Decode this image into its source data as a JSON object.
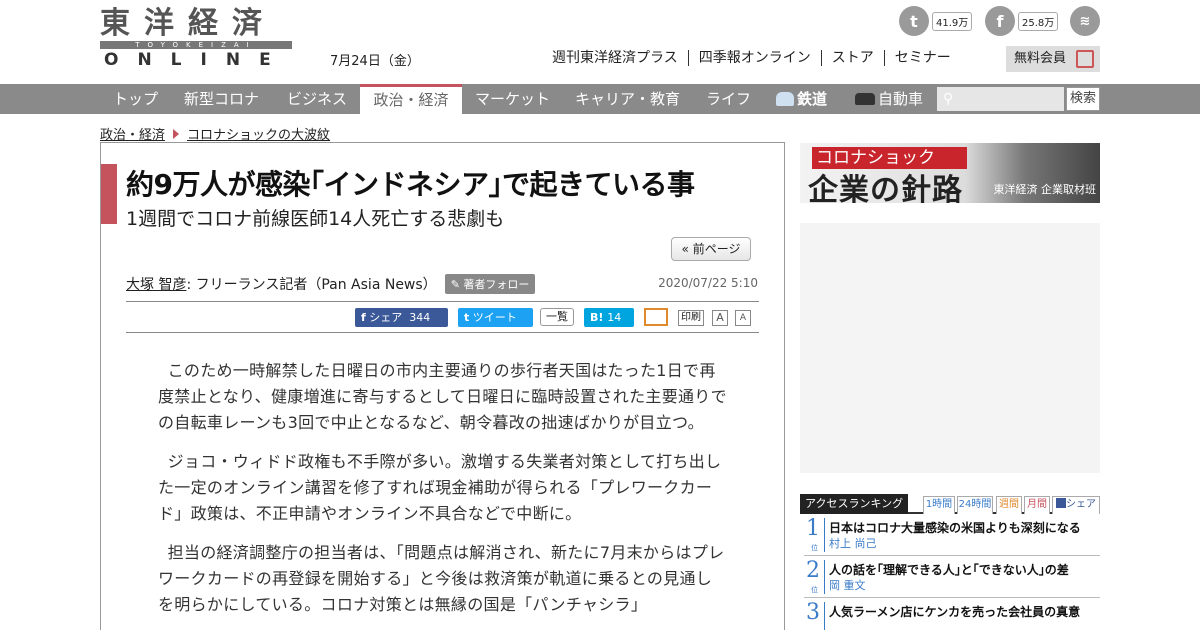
{
  "header": {
    "logo_jp": "東洋経済",
    "logo_bar": "TOYOKEIZAI",
    "logo_en": "ONLINE",
    "date": "7月24日（金）",
    "top_links": [
      "週刊東洋経済プラス",
      "四季報オンライン",
      "ストア",
      "セミナー"
    ],
    "member_label": "無料会員",
    "social": {
      "twitter_count": "41.9万",
      "facebook_count": "25.8万"
    }
  },
  "nav": {
    "items": [
      "トップ",
      "新型コロナ",
      "ビジネス",
      "政治・経済",
      "マーケット",
      "キャリア・教育",
      "ライフ",
      "鉄道",
      "自動車"
    ],
    "active": "政治・経済",
    "search_button": "検索"
  },
  "breadcrumb": [
    "政治・経済",
    "コロナショックの大波紋"
  ],
  "article": {
    "title": "約9万人が感染｢インドネシア｣で起きている事",
    "subtitle": "1週間でコロナ前線医師14人死亡する悲劇も",
    "prev_button": "« 前ページ",
    "author_name": "大塚 智彦",
    "author_role": " : フリーランス記者（Pan Asia News）",
    "follow_label": "著者フォロー",
    "published": "2020/07/22 5:10",
    "share": {
      "fb_label": "シェア",
      "fb_count": "344",
      "tw_label": "ツイート",
      "list_label": "一覧",
      "hb_count": "14",
      "print_label": "印刷",
      "font_large": "A",
      "font_small": "A"
    },
    "paragraphs": [
      "このため一時解禁した日曜日の市内主要通りの歩行者天国はたった1日で再度禁止となり、健康増進に寄与するとして日曜日に臨時設置された主要通りでの自転車レーンも3回で中止となるなど、朝令暮改の拙速ばかりが目立つ。",
      "ジョコ・ウィドド政権も不手際が多い。激増する失業者対策として打ち出した一定のオンライン講習を修了すれば現金補助が得られる「プレワークカード」政策は、不正申請やオンライン不具合などで中断に。",
      "担当の経済調整庁の担当者は、「問題点は解消され、新たに7月末からはプレワークカードの再登録を開始する」と今後は救済策が軌道に乗るとの見通しを明らかにしている。コロナ対策とは無縁の国是「パンチャシラ」"
    ]
  },
  "sidebar": {
    "banner_red": "コロナショック",
    "banner_big": "企業の針路",
    "banner_src": "東洋経済 企業取材班",
    "ranking": {
      "title": "アクセスランキング",
      "tabs": [
        "1時間",
        "24時間",
        "週間",
        "月間",
        "シェア"
      ],
      "rank_suffix": "位",
      "items": [
        {
          "num": "1",
          "title": "日本はコロナ大量感染の米国よりも深刻になる",
          "author": "村上 尚己"
        },
        {
          "num": "2",
          "title": "人の話を｢理解できる人｣と｢できない人｣の差",
          "author": "岡 重文"
        },
        {
          "num": "3",
          "title": "人気ラーメン店にケンカを売った会社員の真意",
          "author": ""
        }
      ]
    }
  },
  "colors": {
    "accent_red": "#c4535e",
    "nav_gray": "#8a8a8a",
    "facebook": "#3b5998",
    "twitter": "#1da1f2",
    "hatena": "#00a4de",
    "rank_blue": "#3a7bc8"
  }
}
